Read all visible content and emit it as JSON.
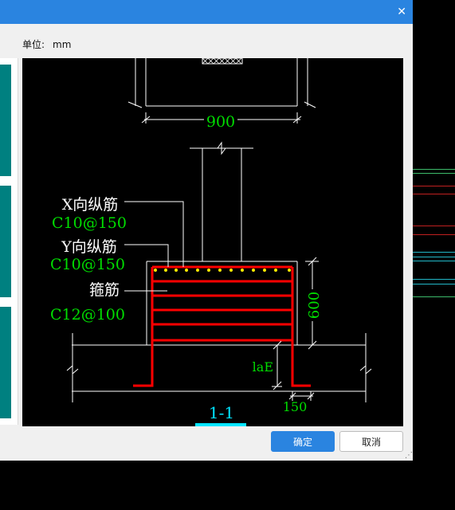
{
  "dialog": {
    "close_glyph": "✕",
    "unit_label": "单位:",
    "unit_value": "mm",
    "buttons": {
      "ok": "确定",
      "cancel": "取消"
    },
    "grip_glyph": "⋰"
  },
  "drawing": {
    "dim_width": "900",
    "dim_height": "600",
    "dim_lae": "laE",
    "dim_anchor": "150",
    "section_label": "1-1",
    "x_rebar_label": "X向纵筋",
    "x_rebar_value": "C10@150",
    "y_rebar_label": "Y向纵筋",
    "y_rebar_value": "C10@150",
    "stirrup_label": "箍筋",
    "stirrup_value": "C12@100"
  },
  "colors": {
    "title_bar": "#2a84e0",
    "dialog_bg": "#f0f0f0",
    "canvas_bg": "#000000",
    "rebar_red": "#ff0000",
    "dimension_green": "#00dd00",
    "label_white": "#ffffff",
    "section_cyan": "#00e5ff",
    "teal_card": "#008080"
  }
}
